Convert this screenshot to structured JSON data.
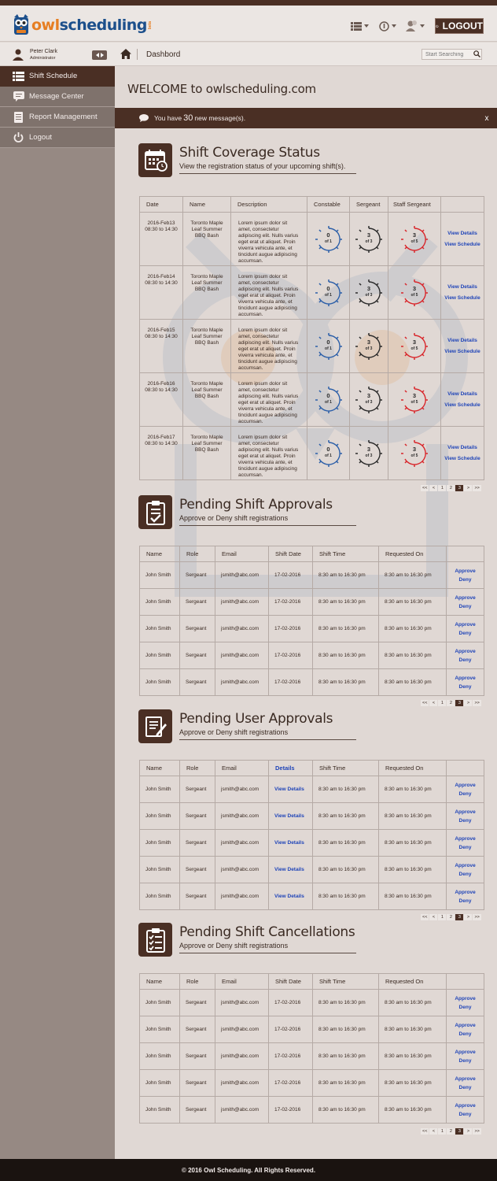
{
  "header": {
    "logo_owl": "owl",
    "logo_scheduling": "scheduling",
    "logo_beta": "beta",
    "logout_label": "LOGOUT"
  },
  "profile": {
    "name": "Peter Clark",
    "role": "Administrator"
  },
  "sidebar": {
    "items": [
      {
        "label": "Shift Schedule",
        "icon": "list-icon",
        "active": true
      },
      {
        "label": "Message Center",
        "icon": "chat-icon",
        "active": false
      },
      {
        "label": "Report Management",
        "icon": "report-icon",
        "active": false
      },
      {
        "label": "Logout",
        "icon": "power-icon",
        "active": false
      }
    ]
  },
  "breadcrumb": {
    "title": "Dashbord"
  },
  "search": {
    "placeholder": "Start Searching"
  },
  "welcome": {
    "prefix": "WELCOME",
    "site": " to owlscheduling.com"
  },
  "messages": {
    "prefix": "You have ",
    "count": "30",
    "suffix": " new message(s).",
    "close": "x"
  },
  "coverage": {
    "title": "Shift Coverage Status",
    "subtitle": "View the registration status of your upcoming shift(s).",
    "columns": [
      "Date",
      "Name",
      "Description",
      "Constable",
      "Sergeant",
      "Staff Sergeant",
      ""
    ],
    "rows": [
      {
        "date": "2016-Feb13",
        "time": "08:30 to 14:30",
        "name": "Toronto Maple Leaf Summer BBQ Bash",
        "desc": "Lorem ipsum dolor sit amet, consectetur adipiscing elit. Nulls varius eget erat ut aliquet. Proin viverra vehicula ante, et tincidunt augue adipiscing accumsan.",
        "constable": {
          "n": "0",
          "of": "of 1"
        },
        "sergeant": {
          "n": "3",
          "of": "of 3"
        },
        "staff": {
          "n": "3",
          "of": "of 5"
        },
        "link1": "View Details",
        "link2": "View Schedule"
      },
      {
        "date": "2016-Feb14",
        "time": "08:30 to 14:30",
        "name": "Toronto Maple Leaf Summer BBQ Bash",
        "desc": "Lorem ipsum dolor sit amet, consectetur adipiscing elit. Nulls varius eget erat ut aliquet. Proin viverra vehicula ante, et tincidunt augue adipiscing accumsan.",
        "constable": {
          "n": "0",
          "of": "of 1"
        },
        "sergeant": {
          "n": "3",
          "of": "of 3"
        },
        "staff": {
          "n": "3",
          "of": "of 5"
        },
        "link1": "View Details",
        "link2": "View Schedule"
      },
      {
        "date": "2016-Feb15",
        "time": "08:30 to 14:30",
        "name": "Toronto Maple Leaf Summer BBQ Bash",
        "desc": "Lorem ipsum dolor sit amet, consectetur adipiscing elit. Nulls varius eget erat ut aliquet. Proin viverra vehicula ante, et tincidunt augue adipiscing accumsan.",
        "constable": {
          "n": "0",
          "of": "of 1"
        },
        "sergeant": {
          "n": "3",
          "of": "of 3"
        },
        "staff": {
          "n": "3",
          "of": "of 5"
        },
        "link1": "View Details",
        "link2": "View Schedule"
      },
      {
        "date": "2016-Feb16",
        "time": "08:30 to 14:30",
        "name": "Toronto Maple Leaf Summer BBQ Bash",
        "desc": "Lorem ipsum dolor sit amet, consectetur adipiscing elit. Nulls varius eget erat ut aliquet. Proin viverra vehicula ante, et tincidunt augue adipiscing accumsan.",
        "constable": {
          "n": "0",
          "of": "of 1"
        },
        "sergeant": {
          "n": "3",
          "of": "of 3"
        },
        "staff": {
          "n": "3",
          "of": "of 5"
        },
        "link1": "View Details",
        "link2": "View Schedule"
      },
      {
        "date": "2016-Feb17",
        "time": "08:30 to 14:30",
        "name": "Toronto Maple Leaf Summer BBQ Bash",
        "desc": "Lorem ipsum dolor sit amet, consectetur adipiscing elit. Nulls varius eget erat ut aliquet. Proin viverra vehicula ante, et tincidunt augue adipiscing accumsan.",
        "constable": {
          "n": "0",
          "of": "of 1"
        },
        "sergeant": {
          "n": "3",
          "of": "of 3"
        },
        "staff": {
          "n": "3",
          "of": "of 5"
        },
        "link1": "View Details",
        "link2": "View Schedule"
      }
    ]
  },
  "gauge_colors": {
    "constable": "#2c5fa8",
    "sergeant": "#2a2a2a",
    "staff": "#d8262b"
  },
  "pager": [
    "<<",
    "<",
    "1",
    "2",
    "3",
    ">",
    ">>"
  ],
  "pager_current": "3",
  "shift_approvals": {
    "title": "Pending Shift Approvals",
    "subtitle": "Approve or Deny shift registrations",
    "columns": [
      "Name",
      "Role",
      "Email",
      "Shift Date",
      "Shift Time",
      "Requested On",
      ""
    ],
    "rows": [
      {
        "name": "John Smith",
        "role": "Sergeant",
        "email": "jsmith@abc.com",
        "date": "17-02-2016",
        "time": "8:30 am to 16:30 pm",
        "requested": "8:30 am to 16:30 pm",
        "approve": "Approve",
        "deny": "Deny"
      },
      {
        "name": "John Smith",
        "role": "Sergeant",
        "email": "jsmith@abc.com",
        "date": "17-02-2016",
        "time": "8:30 am to 16:30 pm",
        "requested": "8:30 am to 16:30 pm",
        "approve": "Approve",
        "deny": "Deny"
      },
      {
        "name": "John Smith",
        "role": "Sergeant",
        "email": "jsmith@abc.com",
        "date": "17-02-2016",
        "time": "8:30 am to 16:30 pm",
        "requested": "8:30 am to 16:30 pm",
        "approve": "Approve",
        "deny": "Deny"
      },
      {
        "name": "John Smith",
        "role": "Sergeant",
        "email": "jsmith@abc.com",
        "date": "17-02-2016",
        "time": "8:30 am to 16:30 pm",
        "requested": "8:30 am to 16:30 pm",
        "approve": "Approve",
        "deny": "Deny"
      },
      {
        "name": "John Smith",
        "role": "Sergeant",
        "email": "jsmith@abc.com",
        "date": "17-02-2016",
        "time": "8:30 am to 16:30 pm",
        "requested": "8:30 am to 16:30 pm",
        "approve": "Approve",
        "deny": "Deny"
      }
    ]
  },
  "user_approvals": {
    "title": "Pending User Approvals",
    "subtitle": "Approve or Deny shift registrations",
    "columns": [
      "Name",
      "Role",
      "Email",
      "Details",
      "Shift Time",
      "Requested On",
      ""
    ],
    "rows": [
      {
        "name": "John Smith",
        "role": "Sergeant",
        "email": "jsmith@abc.com",
        "details": "View Details",
        "time": "8:30 am to 16:30 pm",
        "requested": "8:30 am to 16:30 pm",
        "approve": "Approve",
        "deny": "Deny"
      },
      {
        "name": "John Smith",
        "role": "Sergeant",
        "email": "jsmith@abc.com",
        "details": "View Details",
        "time": "8:30 am to 16:30 pm",
        "requested": "8:30 am to 16:30 pm",
        "approve": "Approve",
        "deny": "Deny"
      },
      {
        "name": "John Smith",
        "role": "Sergeant",
        "email": "jsmith@abc.com",
        "details": "View Details",
        "time": "8:30 am to 16:30 pm",
        "requested": "8:30 am to 16:30 pm",
        "approve": "Approve",
        "deny": "Deny"
      },
      {
        "name": "John Smith",
        "role": "Sergeant",
        "email": "jsmith@abc.com",
        "details": "View Details",
        "time": "8:30 am to 16:30 pm",
        "requested": "8:30 am to 16:30 pm",
        "approve": "Approve",
        "deny": "Deny"
      },
      {
        "name": "John Smith",
        "role": "Sergeant",
        "email": "jsmith@abc.com",
        "details": "View Details",
        "time": "8:30 am to 16:30 pm",
        "requested": "8:30 am to 16:30 pm",
        "approve": "Approve",
        "deny": "Deny"
      }
    ]
  },
  "cancellations": {
    "title": "Pending Shift Cancellations",
    "subtitle": "Approve or Deny shift registrations",
    "columns": [
      "Name",
      "Role",
      "Email",
      "Shift Date",
      "Shift Time",
      "Requested On",
      ""
    ],
    "rows": [
      {
        "name": "John Smith",
        "role": "Sergeant",
        "email": "jsmith@abc.com",
        "date": "17-02-2016",
        "time": "8:30 am to 16:30 pm",
        "requested": "8:30 am to 16:30 pm",
        "approve": "Approve",
        "deny": "Deny"
      },
      {
        "name": "John Smith",
        "role": "Sergeant",
        "email": "jsmith@abc.com",
        "date": "17-02-2016",
        "time": "8:30 am to 16:30 pm",
        "requested": "8:30 am to 16:30 pm",
        "approve": "Approve",
        "deny": "Deny"
      },
      {
        "name": "John Smith",
        "role": "Sergeant",
        "email": "jsmith@abc.com",
        "date": "17-02-2016",
        "time": "8:30 am to 16:30 pm",
        "requested": "8:30 am to 16:30 pm",
        "approve": "Approve",
        "deny": "Deny"
      },
      {
        "name": "John Smith",
        "role": "Sergeant",
        "email": "jsmith@abc.com",
        "date": "17-02-2016",
        "time": "8:30 am to 16:30 pm",
        "requested": "8:30 am to 16:30 pm",
        "approve": "Approve",
        "deny": "Deny"
      },
      {
        "name": "John Smith",
        "role": "Sergeant",
        "email": "jsmith@abc.com",
        "date": "17-02-2016",
        "time": "8:30 am to 16:30 pm",
        "requested": "8:30 am to 16:30 pm",
        "approve": "Approve",
        "deny": "Deny"
      }
    ]
  },
  "footer": {
    "text": "© 2016 Owl Scheduling. All Rights Reserved."
  },
  "colors": {
    "brand_dark": "#4a2f24",
    "sidebar": "#968983",
    "link": "#1f44b8",
    "logo_orange": "#e67e22",
    "logo_blue": "#1c4f8b"
  }
}
